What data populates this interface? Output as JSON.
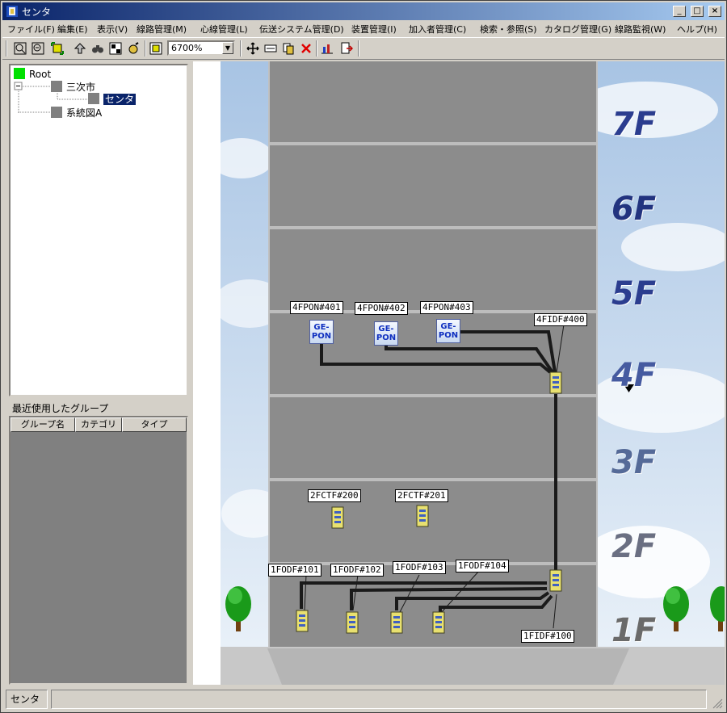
{
  "window": {
    "title": "センタ"
  },
  "menu": [
    "ファイル(F)",
    "編集(E)",
    "表示(V)",
    "線路管理(M)",
    "心線管理(L)",
    "伝送システム管理(D)",
    "装置管理(I)",
    "加入者管理(C)",
    "検索・参照(S)",
    "カタログ管理(G)",
    "線路監視(W)",
    "ヘルプ(H)"
  ],
  "toolbar": {
    "zoom": "6700%"
  },
  "tree": {
    "root": "Root",
    "city": "三次市",
    "center": "センタ",
    "diagram": "系統図A"
  },
  "recent": {
    "label": "最近使用したグループ",
    "columns": [
      "グループ名",
      "カテゴリ",
      "タイプ"
    ]
  },
  "floors": [
    "7F",
    "6F",
    "5F",
    "4F",
    "3F",
    "2F",
    "1F"
  ],
  "devices": {
    "pon401": "4FPON#401",
    "pon402": "4FPON#402",
    "pon403": "4FPON#403",
    "gepon_text": "GE-\nPON",
    "idf400": "4FIDF#400",
    "ctf200": "2FCTF#200",
    "ctf201": "2FCTF#201",
    "odf101": "1FODF#101",
    "odf102": "1FODF#102",
    "odf103": "1FODF#103",
    "odf104": "1FODF#104",
    "idf100": "1FIDF#100"
  },
  "status": {
    "text": "センタ"
  },
  "colors": {
    "building": "#8c8c8c",
    "floor_label": "#2b3d8f",
    "title_start": "#0a246a"
  }
}
